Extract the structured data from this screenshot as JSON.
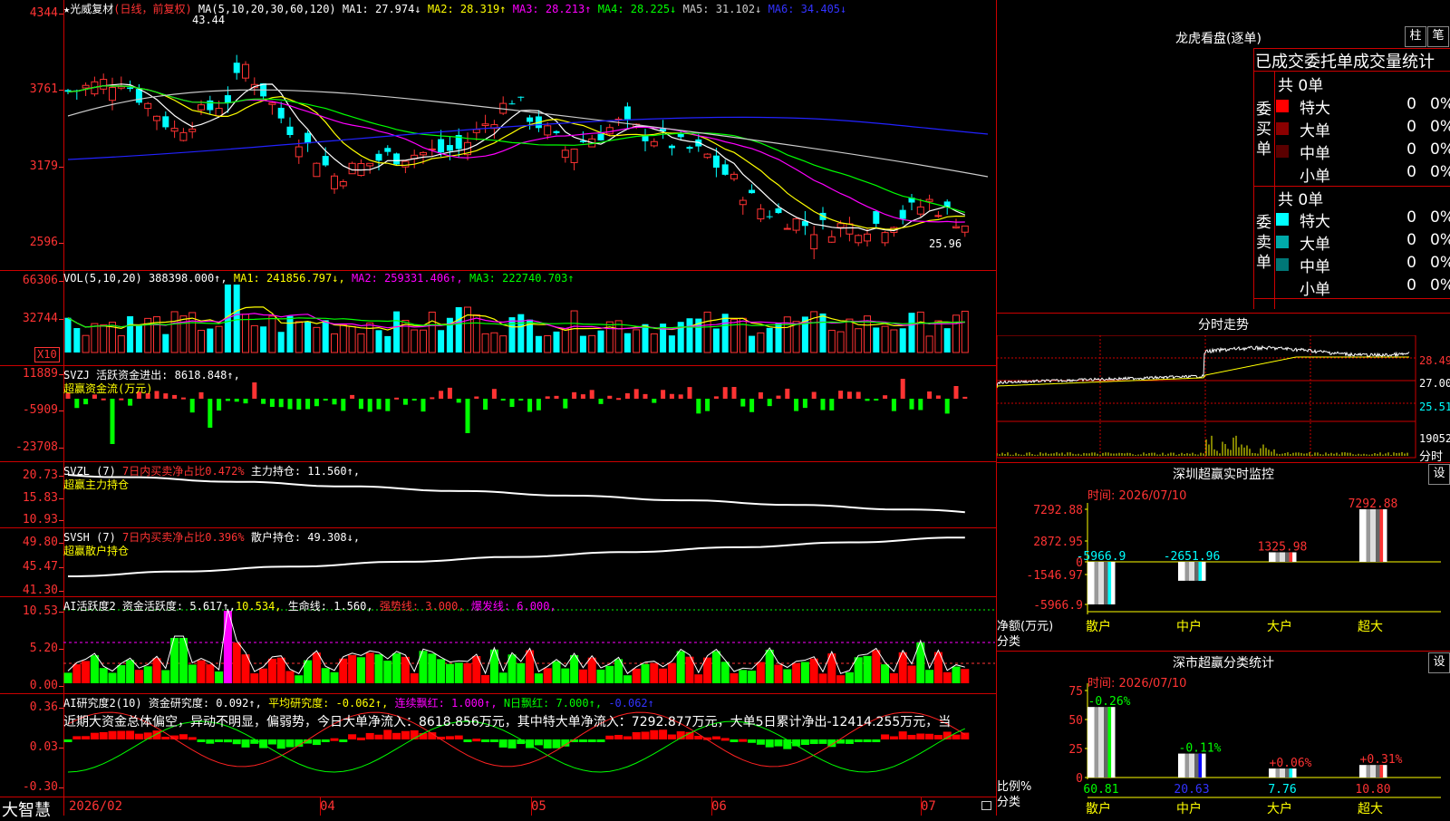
{
  "kline": {
    "title": "★光威复材",
    "period": "(日线，前复权)",
    "ma_label": "MA(5,10,20,30,60,120)",
    "ma": [
      "MA1: 27.974↓",
      "MA2: 28.319↑",
      "MA3: 28.213↑",
      "MA4: 28.225↓",
      "MA5: 31.102↓",
      "MA6: 34.405↓"
    ],
    "ma_colors": [
      "#ffffff",
      "#ffff00",
      "#ff00ff",
      "#00ff00",
      "#cccccc",
      "#2222ff"
    ],
    "high_label": "43.44",
    "low_label": "25.96",
    "axis": [
      "4344",
      "3761",
      "3179",
      "2596"
    ]
  },
  "vol": {
    "label": "VOL(5,10,20)",
    "value": "388398.000↑,",
    "ma": [
      "MA1: 241856.797↓,",
      "MA2: 259331.406↑,",
      "MA3: 222740.703↑"
    ],
    "axis": [
      "66306",
      "32744"
    ],
    "unit": "X10"
  },
  "svzj": {
    "label": "SVZJ",
    "line": "活跃资金进出: 8618.848↑,",
    "sub": "超赢资金流(万元)",
    "axis": [
      "11889",
      "-5909",
      "-23708"
    ]
  },
  "svzl": {
    "label": "SVZL (7)",
    "ratio": "7日内买卖净占比0.472%",
    "line": "主力持仓: 11.560↑,",
    "sub": "超赢主力持仓",
    "axis": [
      "20.73",
      "15.83",
      "10.93"
    ]
  },
  "svsh": {
    "label": "SVSH (7)",
    "ratio": "7日内买卖净占比0.396%",
    "line": "散户持仓: 49.308↓,",
    "sub": "超赢散户持仓",
    "axis": [
      "49.80",
      "45.47",
      "41.30"
    ]
  },
  "ai_active": {
    "label": "AI活跃度2",
    "p1": "资金活跃度: 5.617↑,",
    "p2": "10.534,",
    "p3": "生命线: 1.560,",
    "p4": "强势线: 3.000,",
    "p5": "爆发线: 6.000,",
    "axis": [
      "10.53",
      "5.20",
      "0.00"
    ]
  },
  "ai_research": {
    "label": "AI研究度2(10)",
    "p1": "资金研究度: 0.092↑,",
    "p2": "平均研究度: -0.062↑,",
    "p3": "连续飘红: 1.000↑,",
    "p4": "N日飘红: 7.000↑,",
    "p5": "-0.062↑",
    "desc": "近期大资金总体偏空，异动不明显，偏弱势，今日大单净流入：8618.856万元，其中特大单净流入：7292.877万元，大单5日累计净出-12414.255万元，当",
    "axis": [
      "0.36",
      "0.03",
      "-0.30"
    ]
  },
  "bottom": {
    "brand": "大智慧",
    "dates": [
      "2026/02",
      "04",
      "05",
      "06",
      "07"
    ]
  },
  "lhb": {
    "title": "龙虎看盘(逐单)",
    "btn1": "柱",
    "btn2": "笔",
    "subtitle": "已成交委托单成交量统计",
    "buy_label": "委买单",
    "sell_label": "委卖单",
    "buy_total": "共 0单",
    "sell_total": "共 0单",
    "buy_rows": [
      {
        "label": "特大",
        "count": "0",
        "pct": "0%",
        "color": "#ff0000"
      },
      {
        "label": "大单",
        "count": "0",
        "pct": "0%",
        "color": "#8b0000"
      },
      {
        "label": "中单",
        "count": "0",
        "pct": "0%",
        "color": "#5a0000"
      },
      {
        "label": "小单",
        "count": "0",
        "pct": "0%",
        "color": "#000000"
      }
    ],
    "sell_rows": [
      {
        "label": "特大",
        "count": "0",
        "pct": "0%",
        "color": "#00ffff"
      },
      {
        "label": "大单",
        "count": "0",
        "pct": "0%",
        "color": "#00aaaa"
      },
      {
        "label": "中单",
        "count": "0",
        "pct": "0%",
        "color": "#007777"
      },
      {
        "label": "小单",
        "count": "0",
        "pct": "0%",
        "color": "#000000"
      }
    ]
  },
  "intraday": {
    "title": "分时走势",
    "axis": [
      "28.49",
      "27.00",
      "25.51"
    ],
    "vol_axis": "19052",
    "vol_label": "分时"
  },
  "monitor": {
    "title": "深圳超赢实时监控",
    "btn": "设",
    "time": "时间: 2026/07/10",
    "axis": [
      "7292.88",
      "2872.95",
      "0",
      "-1546.97",
      "-5966.9"
    ],
    "ylabel1": "净额(万元)",
    "ylabel2": "分类",
    "categories": [
      "散户",
      "中户",
      "大户",
      "超大"
    ],
    "values": [
      -5966.9,
      -2651.96,
      1325.98,
      7292.88
    ],
    "value_labels": [
      "-5966.9",
      "-2651.96",
      "1325.98",
      "7292.88"
    ]
  },
  "classify": {
    "title": "深市超赢分类统计",
    "btn": "设",
    "time": "时间: 2026/07/10",
    "axis": [
      "75",
      "50",
      "25",
      "0"
    ],
    "ylabel1": "比例%",
    "ylabel2": "分类",
    "categories": [
      "散户",
      "中户",
      "大户",
      "超大"
    ],
    "values": [
      60.81,
      20.63,
      7.76,
      10.8
    ],
    "value_labels": [
      "60.81",
      "20.63",
      "7.76",
      "10.80"
    ],
    "changes": [
      "-0.26%",
      "-0.11%",
      "+0.06%",
      "+0.31%"
    ]
  }
}
